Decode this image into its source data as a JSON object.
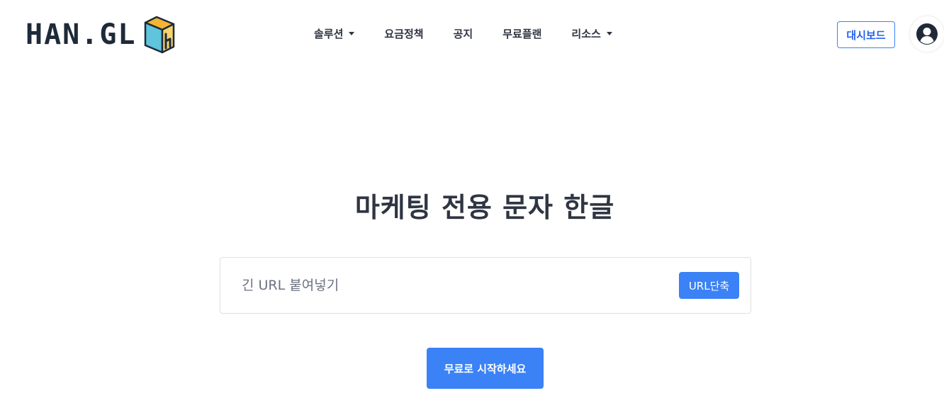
{
  "logo": {
    "text": "HAN.GL"
  },
  "nav": {
    "items": [
      {
        "label": "솔루션",
        "has_dropdown": true
      },
      {
        "label": "요금정책",
        "has_dropdown": false
      },
      {
        "label": "공지",
        "has_dropdown": false
      },
      {
        "label": "무료플랜",
        "has_dropdown": false
      },
      {
        "label": "리소스",
        "has_dropdown": true
      }
    ]
  },
  "header": {
    "dashboard_label": "대시보드",
    "avatar_icon": "user-circle-icon"
  },
  "hero": {
    "title": "마케팅 전용 문자 한글"
  },
  "shortener": {
    "placeholder": "긴 URL 붙여넣기",
    "value": "",
    "button_label": "URL단축"
  },
  "cta": {
    "label": "무료로 시작하세요"
  },
  "colors": {
    "primary": "#3b82f6",
    "text": "#2f3542",
    "border": "#dcdfe4",
    "logo_box_yellow": "#f2b632",
    "logo_box_cyan": "#5fc4dc"
  }
}
